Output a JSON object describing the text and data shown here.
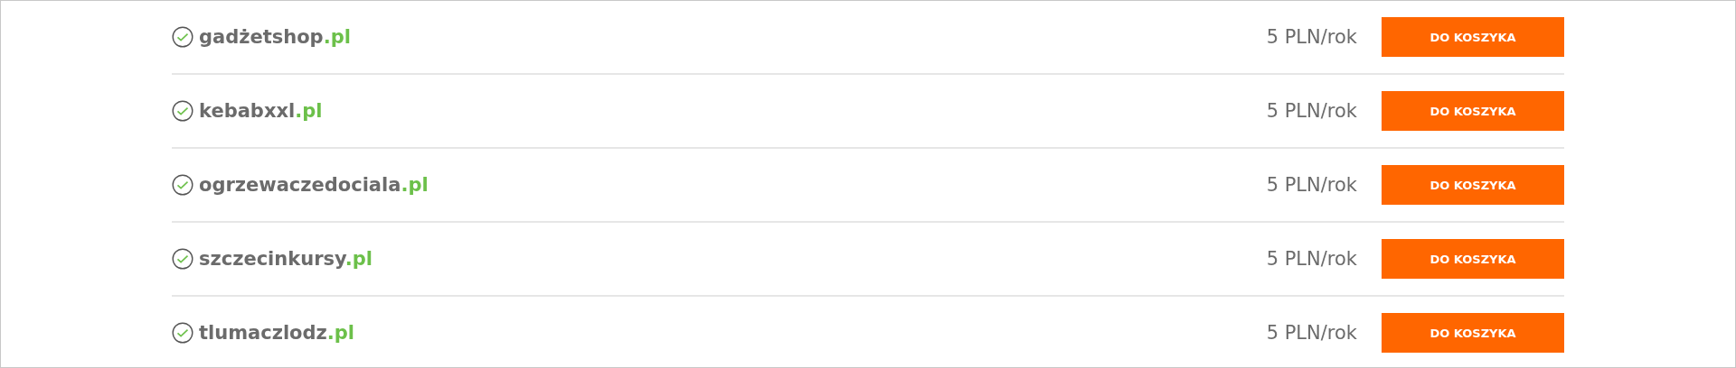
{
  "domains": [
    {
      "name": "gadżetshop",
      "tld": ".pl",
      "available": true,
      "price": "5 PLN/rok",
      "button": "DO KOSZYKA"
    },
    {
      "name": "kebabxxl",
      "tld": ".pl",
      "available": true,
      "price": "5 PLN/rok",
      "button": "DO KOSZYKA"
    },
    {
      "name": "ogrzewaczedociala",
      "tld": ".pl",
      "available": true,
      "price": "5 PLN/rok",
      "button": "DO KOSZYKA"
    },
    {
      "name": "szczecinkursy",
      "tld": ".pl",
      "available": true,
      "price": "5 PLN/rok",
      "button": "DO KOSZYKA"
    },
    {
      "name": "tlumaczlodz",
      "tld": ".pl",
      "available": true,
      "price": "5 PLN/rok",
      "button": "DO KOSZYKA"
    }
  ]
}
